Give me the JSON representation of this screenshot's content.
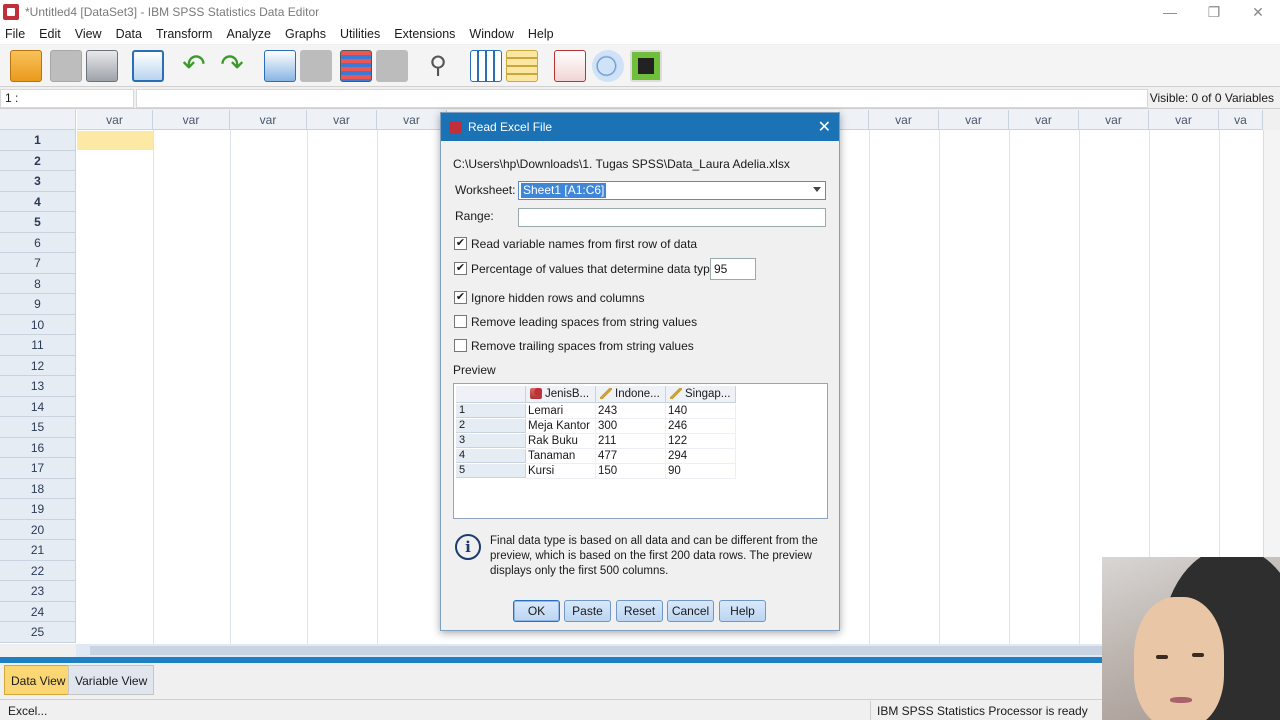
{
  "window": {
    "title": "*Untitled4 [DataSet3] - IBM SPSS Statistics Data Editor",
    "minimize": "—",
    "restore": "❐",
    "close": "✕"
  },
  "menu": [
    "File",
    "Edit",
    "View",
    "Data",
    "Transform",
    "Analyze",
    "Graphs",
    "Utilities",
    "Extensions",
    "Window",
    "Help"
  ],
  "toolbar_icons": [
    "open-folder-icon",
    "save-icon",
    "print-icon",
    "dialog-recall-icon",
    "undo-icon",
    "redo-icon",
    "goto-case-icon",
    "goto-variable-icon",
    "variables-icon",
    "run-descriptives-icon",
    "find-icon",
    "insert-cases-icon",
    "insert-variable-icon",
    "value-labels-icon",
    "use-sets-icon",
    "add-ons-icon"
  ],
  "cell_ref": "1 :",
  "visible_vars": "Visible: 0 of 0 Variables",
  "grid": {
    "columns_left": [
      "var",
      "var",
      "var",
      "var",
      "var"
    ],
    "columns_right": [
      "var",
      "var",
      "var",
      "var",
      "var",
      "var",
      "va"
    ],
    "rows": [
      "1",
      "2",
      "3",
      "4",
      "5",
      "6",
      "7",
      "8",
      "9",
      "10",
      "11",
      "12",
      "13",
      "14",
      "15",
      "16",
      "17",
      "18",
      "19",
      "20",
      "21",
      "22",
      "23",
      "24",
      "25"
    ]
  },
  "tabs": {
    "data_view": "Data View",
    "variable_view": "Variable View"
  },
  "status": {
    "left": "Excel...",
    "right": "IBM SPSS Statistics Processor is ready"
  },
  "dialog": {
    "title": "Read Excel File",
    "close": "✕",
    "path": "C:\\Users\\hp\\Downloads\\1. Tugas SPSS\\Data_Laura Adelia.xlsx",
    "worksheet_label": "Worksheet:",
    "worksheet_value": "Sheet1 [A1:C6]",
    "range_label": "Range:",
    "range_value": "",
    "options": [
      {
        "label": "Read variable names from first row of data",
        "checked": true
      },
      {
        "label": "Percentage of values that determine data type:",
        "checked": true
      },
      {
        "label": "Ignore hidden rows and columns",
        "checked": true
      },
      {
        "label": "Remove leading spaces from string values",
        "checked": false
      },
      {
        "label": "Remove trailing spaces from string values",
        "checked": false
      }
    ],
    "percentage_value": "95",
    "check_mark": "✔",
    "preview_label": "Preview",
    "preview": {
      "headers": [
        "JenisB...",
        "Indone...",
        "Singap..."
      ],
      "rows": [
        {
          "n": "1",
          "c1": "Lemari",
          "c2": "243",
          "c3": "140"
        },
        {
          "n": "2",
          "c1": "Meja Kantor",
          "c2": "300",
          "c3": "246"
        },
        {
          "n": "3",
          "c1": "Rak Buku",
          "c2": "211",
          "c3": "122"
        },
        {
          "n": "4",
          "c1": "Tanaman",
          "c2": "477",
          "c3": "294"
        },
        {
          "n": "5",
          "c1": "Kursi",
          "c2": "150",
          "c3": "90"
        }
      ]
    },
    "info_glyph": "i",
    "info_text": "Final data type is based on all data and can be different from the preview, which is based on the first 200 data rows. The preview displays only the first 500 columns.",
    "buttons": {
      "ok": "OK",
      "paste": "Paste",
      "reset": "Reset",
      "cancel": "Cancel",
      "help": "Help"
    }
  },
  "colors": {
    "accent": "#1b73b6",
    "active_cell": "#fde9a6",
    "active_tab": "#fbd774",
    "brand": "#c0303a"
  }
}
